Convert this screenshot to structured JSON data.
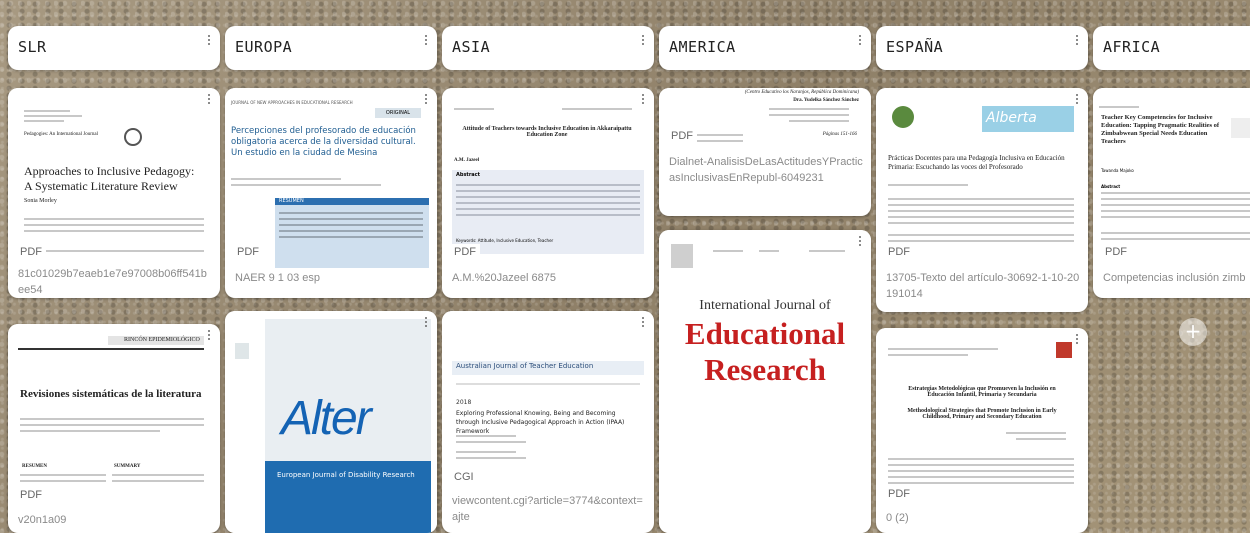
{
  "columns": [
    {
      "title": "SLR",
      "cards": [
        {
          "type": "PDF",
          "caption": "81c01029b7eaeb1e7e97008b06ff541bee54",
          "thumb": {
            "kicker": "Pedagogies: An International Journal",
            "title": "Approaches to Inclusive Pedagogy: A Systematic Literature Review",
            "author": "Sonia Morley"
          }
        },
        {
          "type": "PDF",
          "caption": "v20n1a09",
          "thumb": {
            "kicker": "RINCÓN EPIDEMIOLÓGICO",
            "title": "Revisiones sistemáticas de la literatura",
            "left_head": "RESUMEN",
            "right_head": "SUMMARY"
          }
        }
      ]
    },
    {
      "title": "EUROPA",
      "cards": [
        {
          "type": "PDF",
          "caption": "NAER 9 1 03 esp",
          "thumb": {
            "kicker": "JOURNAL OF NEW APPROACHES IN EDUCATIONAL RESEARCH",
            "badge": "ORIGINAL",
            "title": "Percepciones del profesorado de educación obligatoria acerca de la diversidad cultural. Un estudio en la ciudad de Mesina",
            "box_head": "RESUMEN"
          }
        },
        {
          "type": "",
          "caption": "",
          "thumb": {
            "title": "Alter",
            "subtitle": "European Journal of Disability Research"
          }
        }
      ]
    },
    {
      "title": "ASIA",
      "cards": [
        {
          "type": "PDF",
          "caption": "A.M.%20Jazeel 6875",
          "thumb": {
            "title": "Attitude of Teachers towards Inclusive Education in Akkaraipattu Education Zone",
            "author": "A.M. Jazeel",
            "box_head": "Abstract",
            "keywords": "Keywords: Attitude, Inclusive Education, Teacher"
          }
        },
        {
          "type": "CGI",
          "caption": "viewcontent.cgi?article=3774&context=ajte",
          "thumb": {
            "journal": "Australian Journal of Teacher Education",
            "year": "2018",
            "title": "Exploring Professional Knowing, Being and Becoming through Inclusive Pedagogical Approach in Action (IPAA) Framework"
          }
        }
      ]
    },
    {
      "title": "AMERICA",
      "cards": [
        {
          "type": "PDF",
          "caption": "Dialnet-AnalisisDeLasActitudesYPracticasInclusivasEnRepubl-6049231",
          "thumb": {
            "line1": "(Centro Educativo los Naranjos, República Dominicana)",
            "line2": "Dra. Yudelka Sánchez Sánchez",
            "line3": "Páginas 151-166"
          }
        },
        {
          "type": "",
          "caption": "",
          "thumb": {
            "title_line1": "International Journal of",
            "title_line2": "Educational",
            "title_line3": "Research"
          }
        }
      ]
    },
    {
      "title": "ESPAÑA",
      "cards": [
        {
          "type": "PDF",
          "caption": "13705-Texto del artículo-30692-1-10-20191014",
          "thumb": {
            "logo": "Alberta",
            "title": "Prácticas Docentes para una Pedagogía Inclusiva en Educación Primaria: Escuchando las voces del Profesorado"
          }
        },
        {
          "type": "PDF",
          "caption": "0 (2)",
          "thumb": {
            "title": "Estrategias Metodológicas que Promueven la Inclusión en Educación Infantil, Primaria y Secundaria",
            "subtitle": "Methodological Strategies that Promote Inclusion in Early Childhood, Primary and Secondary Education"
          }
        }
      ]
    },
    {
      "title": "AFRICA",
      "cards": [
        {
          "type": "PDF",
          "caption": "Competencias inclusión zimbawe",
          "thumb": {
            "title": "Teacher Key Competencies for Inclusive Education: Tapping Pragmatic Realities of Zimbabwean Special Needs Education Teachers",
            "author": "Tawanda Majoko",
            "box_head": "Abstract"
          }
        }
      ]
    }
  ],
  "add_label": "+"
}
